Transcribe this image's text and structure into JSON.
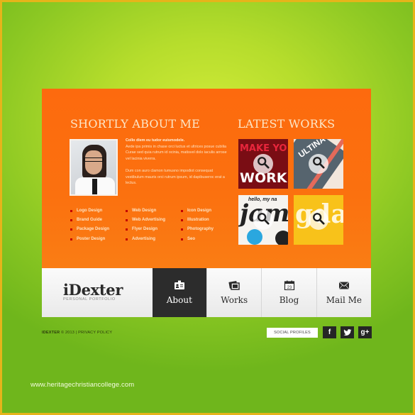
{
  "about": {
    "title": "SHORTLY ABOUT ME",
    "bio_lead": "Collo diem eu tudor euismodele.",
    "bio_p1": "Aede ipa primis in chase orci luctus et ultrices posue cubilia Curae sed quia rutrum id ocinia, matisvel dolo iaculis arrose vel lacinia viverra.",
    "bio_p2": "Dum con auro clamon tumusno impodiot consequat vestibulum mauris orci rutrum ipsum, id dapibuseroc erat a lectus.",
    "photo_alt": "profile-photo",
    "services": [
      [
        "Logo Design",
        "Brand Guide",
        "Package Design",
        "Poster Design"
      ],
      [
        "Web Design",
        "Web Advertising",
        "Flyer Design",
        "Advertising"
      ],
      [
        "Icon Design",
        "Illustration",
        "Photography",
        "Seo"
      ]
    ]
  },
  "works": {
    "title": "LATEST WORKS",
    "tiles": [
      {
        "name": "make-your-own-work",
        "line1": "MAKE YO",
        "line2": "WORK"
      },
      {
        "name": "ultima-about",
        "line1": "ULTINA"
      },
      {
        "name": "hello-my-name-jam",
        "line1": "hello, my na",
        "line2": "jam"
      },
      {
        "name": "gda",
        "line1": "gda"
      }
    ]
  },
  "nav": {
    "brand_name": "iDexter",
    "brand_tagline": "PERSONAL PORTFOLIO",
    "items": [
      {
        "label": "About",
        "icon": "id-card-icon",
        "active": true
      },
      {
        "label": "Works",
        "icon": "photos-icon",
        "active": false
      },
      {
        "label": "Blog",
        "icon": "calendar-icon",
        "active": false,
        "icon_text": "23"
      },
      {
        "label": "Mail Me",
        "icon": "envelope-icon",
        "active": false
      }
    ]
  },
  "footer": {
    "brand": "IDEXTER",
    "copyright": "© 2013 | PRIVACY POLICY",
    "social_label": "SOCIAL PROFILES",
    "social": [
      {
        "name": "facebook",
        "glyph": "f"
      },
      {
        "name": "twitter",
        "glyph": "t"
      },
      {
        "name": "google-plus",
        "glyph": "g+"
      }
    ]
  },
  "watermark": "www.heritagechristiancollege.com",
  "colors": {
    "panel": "#fb6d0f",
    "nav_active": "#2c2c2c",
    "background": "#b6dd2c",
    "border": "#e6b41a"
  }
}
